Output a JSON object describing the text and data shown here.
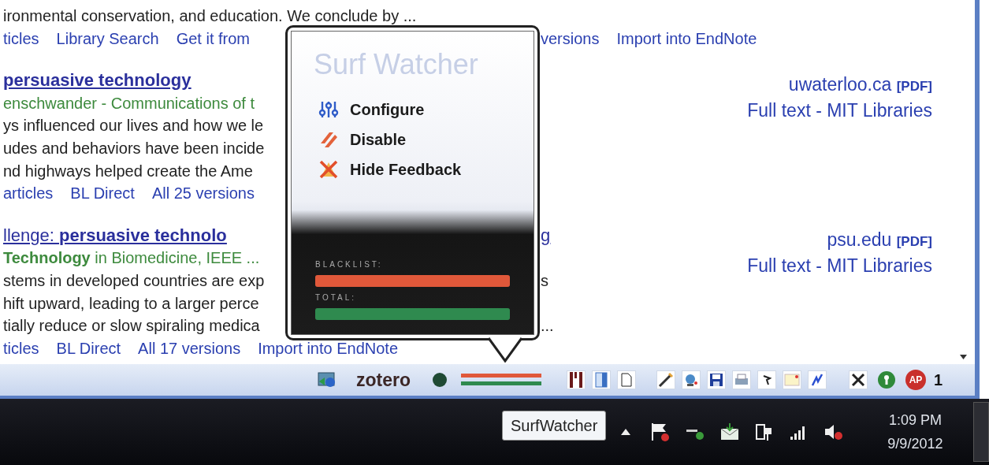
{
  "results": [
    {
      "lines": [
        {
          "kind": "snippet",
          "left": "ironmental conservation, and education. We conclude by ..."
        },
        {
          "kind": "links",
          "left": [
            "ticles",
            "Library Search",
            "Get it from"
          ],
          "right": [
            "versions",
            "Import into EndNote"
          ]
        }
      ]
    },
    {
      "lines": [
        {
          "kind": "title",
          "emphasis": true,
          "left": "persuasive technology"
        },
        {
          "kind": "source",
          "left": "enschwander - Communications of t"
        },
        {
          "kind": "snippet",
          "left": "ys influenced our lives and how we le"
        },
        {
          "kind": "snippet",
          "left": "udes and behaviors have been incide"
        },
        {
          "kind": "snippet",
          "left": "nd highways helped create the Ame"
        },
        {
          "kind": "links",
          "left": [
            "articles",
            "BL Direct",
            "All 25 versions"
          ]
        }
      ],
      "side": {
        "site": "uwaterloo.ca",
        "tag": "[PDF]",
        "full_text": "Full text - MIT Libraries"
      }
    },
    {
      "lines": [
        {
          "kind": "title",
          "emphasis": false,
          "left": "llenge: **persuasive technolo**",
          "right": "g"
        },
        {
          "kind": "source",
          "left": "**Technology** in Biomedicine, IEEE ..."
        },
        {
          "kind": "snippet",
          "left": "stems in developed countries are exp",
          "right": "s"
        },
        {
          "kind": "snippet",
          "left": "hift upward, leading to a larger perce"
        },
        {
          "kind": "snippet",
          "left": "tially reduce or slow spiraling medica",
          "right": "..."
        },
        {
          "kind": "links",
          "left": [
            "ticles",
            "BL Direct",
            "All 17 versions",
            "Import into EndNote"
          ]
        }
      ],
      "side": {
        "site": "psu.edu",
        "tag": "[PDF]",
        "full_text": "Full text - MIT Libraries"
      }
    }
  ],
  "popup": {
    "title": "Surf Watcher",
    "menu": [
      {
        "kind": "sliders",
        "label": "Configure"
      },
      {
        "kind": "stripes",
        "label": "Disable"
      },
      {
        "kind": "cross",
        "label": "Hide Feedback"
      }
    ],
    "meters": [
      {
        "label": "BLACKLIST:",
        "level": 1,
        "color": "#e0583a"
      },
      {
        "label": "TOTAL:",
        "level": 1,
        "color": "#2f8a4f"
      }
    ]
  },
  "addon_bar": {
    "zotero": "zotero",
    "logo": "AP",
    "count": "1"
  },
  "taskbar": {
    "tooltip": "SurfWatcher",
    "time": "1:09 PM",
    "date": "9/9/2012"
  }
}
